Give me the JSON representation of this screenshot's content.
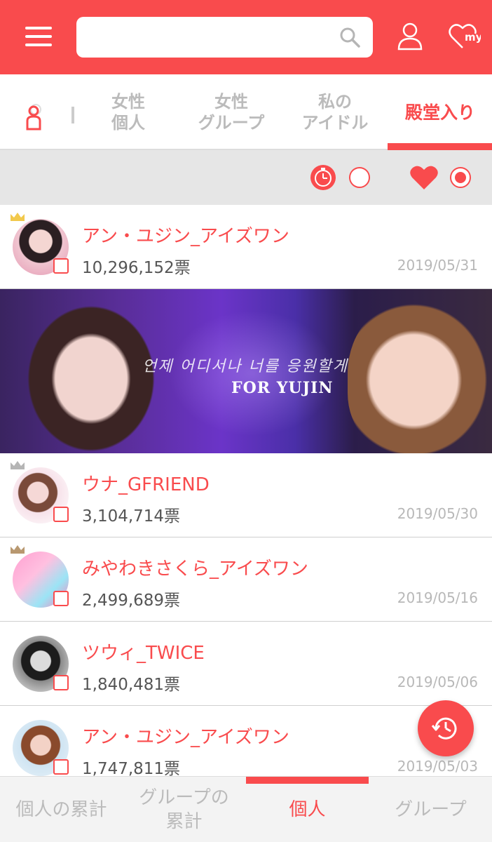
{
  "header": {
    "search": {
      "value": "",
      "placeholder": ""
    },
    "icons": [
      "menu-icon",
      "search-icon",
      "user-icon",
      "my-heart-icon"
    ],
    "my_icon_text": "my"
  },
  "tabs": {
    "items": [
      {
        "label_line1": "女性",
        "label_line2": "個人"
      },
      {
        "label_line1": "女性",
        "label_line2": "グループ"
      },
      {
        "label_line1": "私の",
        "label_line2": "アイドル"
      },
      {
        "label": "殿堂入り",
        "active": true
      }
    ]
  },
  "filter": {
    "options": [
      {
        "icon": "clock-icon",
        "selected": false
      },
      {
        "icon": "heart-icon",
        "selected": true
      }
    ]
  },
  "rows": [
    {
      "rank": 1,
      "crown": "gold",
      "name": "アン・ユジン_アイズワン",
      "votes": "10,296,152票",
      "date": "2019/05/31"
    },
    {
      "rank": 2,
      "crown": "silver",
      "name": "ウナ_GFRIEND",
      "votes": "3,104,714票",
      "date": "2019/05/30"
    },
    {
      "rank": 3,
      "crown": "bronze",
      "name": "みやわきさくら_アイズワン",
      "votes": "2,499,689票",
      "date": "2019/05/16"
    },
    {
      "rank": 4,
      "crown": "",
      "name": "ツウィ_TWICE",
      "votes": "1,840,481票",
      "date": "2019/05/06"
    },
    {
      "rank": 5,
      "crown": "",
      "name": "アン・ユジン_アイズワン",
      "votes": "1,747,811票",
      "date": "2019/05/03"
    }
  ],
  "banner": {
    "script_text": "언제 어디서나 너를 응원할게",
    "title": "FOR YUJIN"
  },
  "bottom_nav": {
    "items": [
      {
        "label": "個人の累計"
      },
      {
        "label_line1": "グループの",
        "label_line2": "累計"
      },
      {
        "label": "個人",
        "active": true
      },
      {
        "label": "グループ"
      }
    ]
  },
  "colors": {
    "accent": "#f94b4d",
    "inactive_text": "#bbbbbb",
    "filter_bg": "#e6e6e6",
    "crown_gold": "#f2c94c",
    "crown_silver": "#b5b5b5",
    "crown_bronze": "#b89870"
  }
}
